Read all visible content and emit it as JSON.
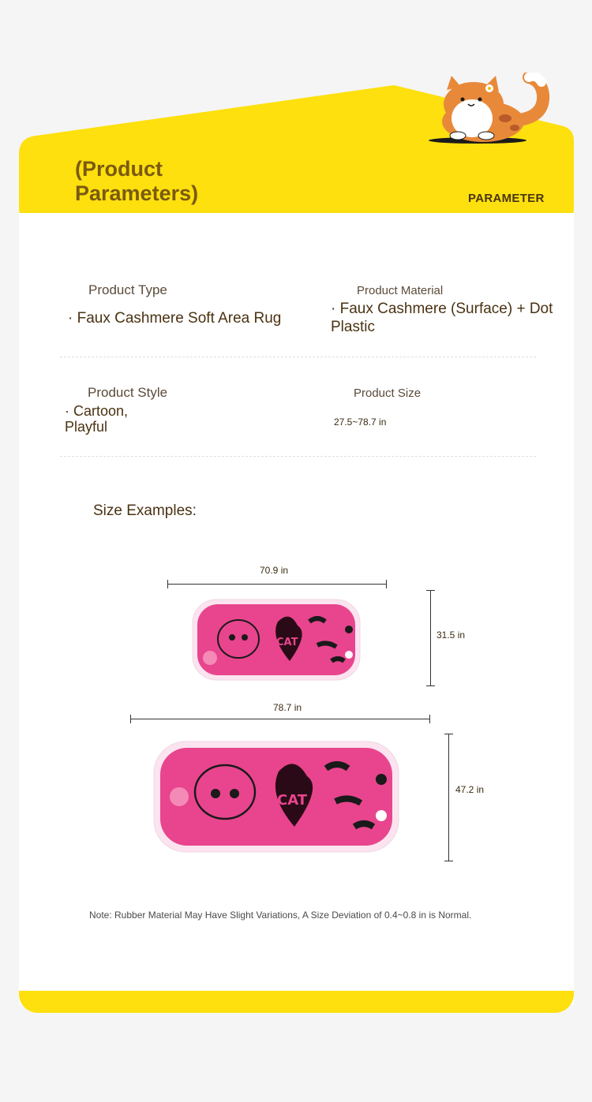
{
  "header": {
    "title": "(Product Parameters)",
    "tag": "PARAMETER"
  },
  "params": {
    "type": {
      "label": "Product Type",
      "value": "· Faux Cashmere Soft Area Rug"
    },
    "material": {
      "label": "Product Material",
      "value": "· Faux Cashmere (Surface) + Dot Plastic"
    },
    "style": {
      "label": "Product Style",
      "value": "· Cartoon, Playful"
    },
    "size": {
      "label": "Product Size",
      "value": "27.5~78.7 in"
    }
  },
  "size_examples": {
    "title": "Size Examples:",
    "small": {
      "width": "70.9 in",
      "height": "31.5 in",
      "print": "CAT"
    },
    "large": {
      "width": "78.7 in",
      "height": "47.2 in",
      "print": "CAT"
    }
  },
  "note": "Note: Rubber Material May Have Slight Variations, A Size Deviation of 0.4~0.8 in is Normal.",
  "colors": {
    "accent": "#fde00e",
    "rug_pink": "#e8458e",
    "title": "#7a5a10"
  },
  "icons": [
    "cat-mascot-icon",
    "cat-rug-image"
  ]
}
